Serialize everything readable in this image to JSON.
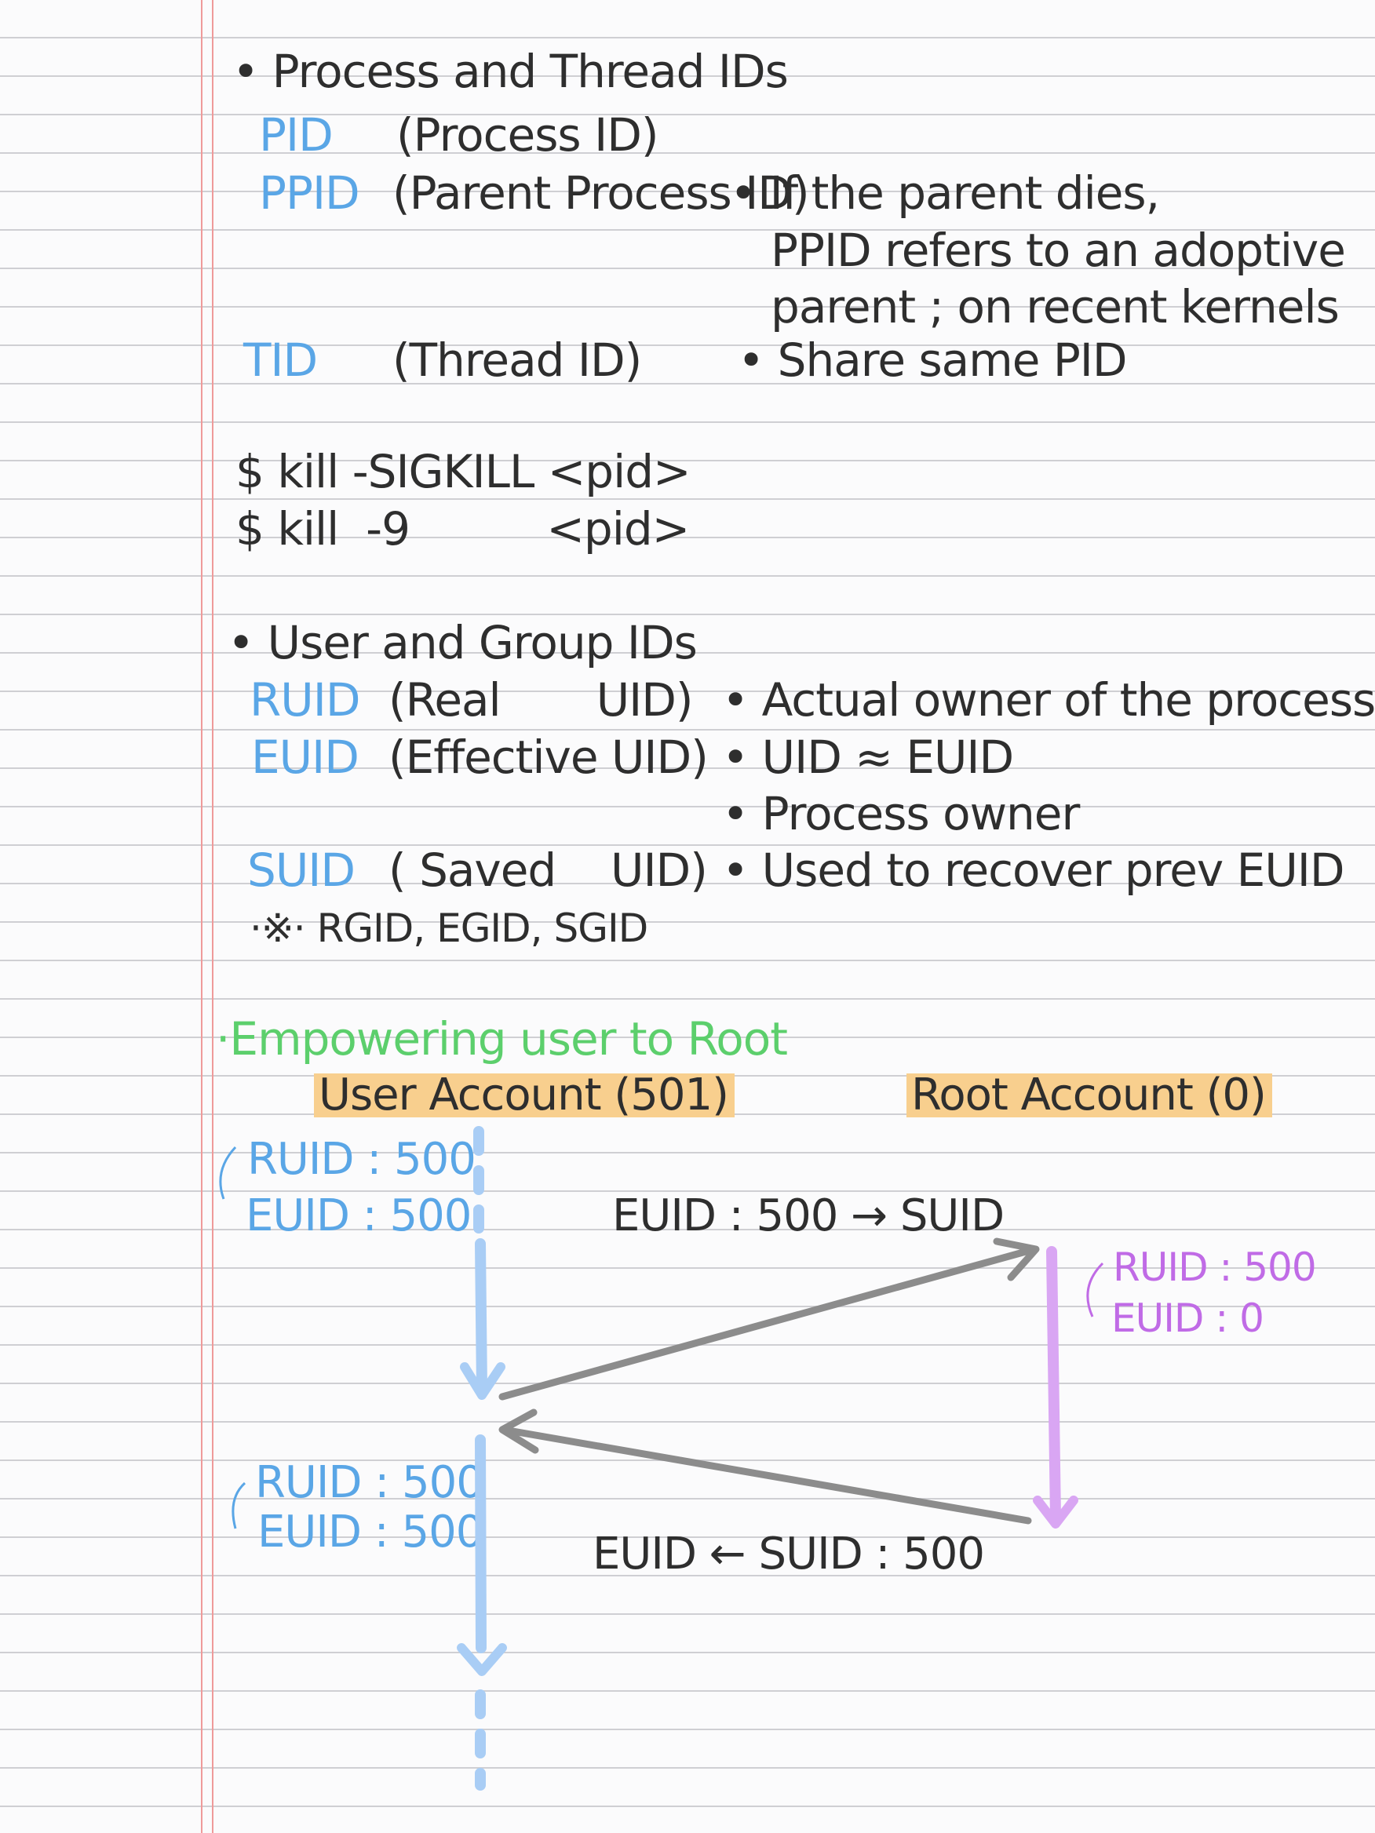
{
  "section_process": {
    "heading": "• Process and Thread IDs",
    "pid": {
      "term": "PID",
      "desc": "(Process ID)"
    },
    "ppid": {
      "term": "PPID",
      "desc": "(Parent Process ID)",
      "note": "• If the parent dies,",
      "note2": "PPID refers to an adoptive",
      "note3": "parent ; on recent kernels"
    },
    "tid": {
      "term": "TID",
      "desc": "(Thread ID)",
      "note": "• Share same PID"
    }
  },
  "commands": {
    "line1": "$ kill  -SIGKILL <pid>",
    "line2": "$ kill  -9          <pid>"
  },
  "section_user": {
    "heading": "• User and Group IDs",
    "ruid": {
      "term": "RUID",
      "desc": "(Real       UID)",
      "note": "• Actual owner of the process"
    },
    "euid": {
      "term": "EUID",
      "desc": "(Effective UID)",
      "note": "• UID ≈ EUID",
      "note2": "• Process owner"
    },
    "suid": {
      "term": "SUID",
      "desc": "( Saved    UID)",
      "note": "• Used to recover prev EUID"
    },
    "footnote": "·※· RGID, EGID, SGID"
  },
  "section_empower": {
    "heading": "·Empowering user to Root",
    "user_account": "User Account (501)",
    "root_account": "Root Account (0)",
    "state1": {
      "ruid": "RUID : 500",
      "euid": "EUID : 500"
    },
    "transition1": "EUID : 500 → SUID",
    "root_state": {
      "ruid": "RUID : 500",
      "euid": "EUID : 0"
    },
    "state2": {
      "ruid": "RUID : 500",
      "euid": "EUID : 500"
    },
    "transition2": "EUID ← SUID : 500"
  },
  "colors": {
    "term_blue": "#5aa6e6",
    "ink": "#2e2e2e",
    "root_purple": "#c06be6",
    "heading_green": "#5ccf6c",
    "highlight": "#f8cf8e",
    "arrow_blue": "#a9cdf5",
    "arrow_gray": "#8c8c8c",
    "arrow_purple": "#d9a6f3"
  }
}
